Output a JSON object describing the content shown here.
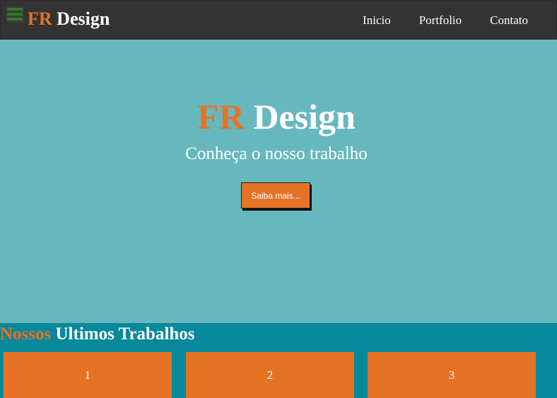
{
  "navbar": {
    "logo_accent": "FR",
    "logo_main": "Design",
    "links": [
      "Inicio",
      "Portfolio",
      "Contato"
    ]
  },
  "hero": {
    "title_accent": "FR",
    "title_main": "Design",
    "subtitle": "Conheça o nosso trabalho",
    "button_label": "Saiba mais..."
  },
  "works": {
    "title_accent": "Nossos",
    "title_main": "Ultimos Trabalhos",
    "cards": [
      "1",
      "2",
      "3"
    ]
  },
  "colors": {
    "accent": "#e57325",
    "navbar": "#333333",
    "hero": "#66b8be",
    "works": "#08889b",
    "menu_icon": "#2e7d1e"
  },
  "icons": {
    "menu": "hamburger-menu-icon"
  }
}
